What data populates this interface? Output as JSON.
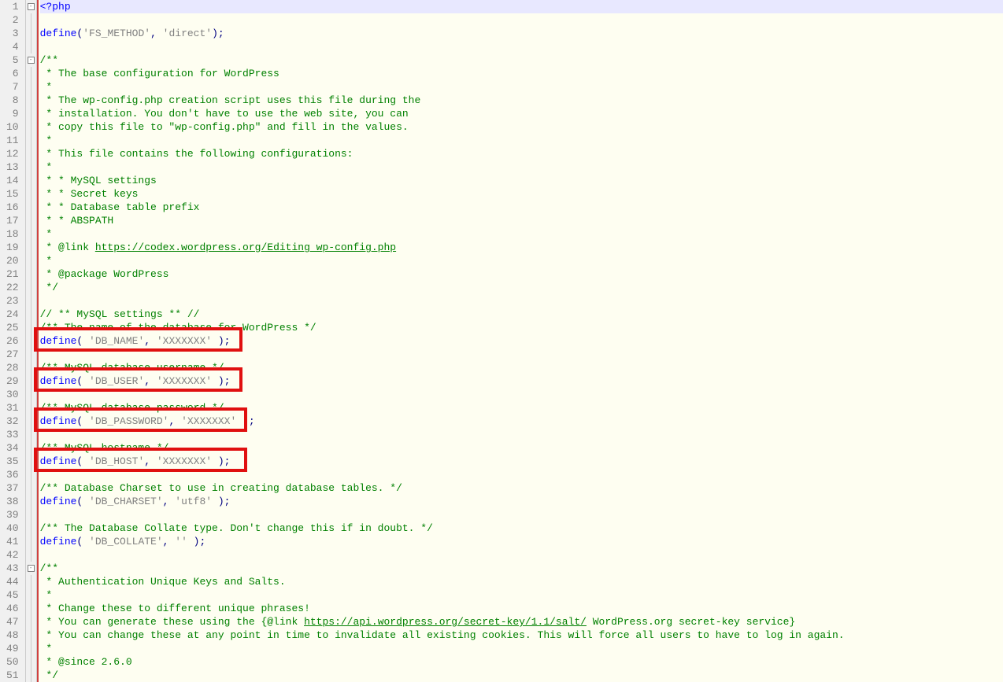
{
  "lines": {
    "1": [
      [
        "kw",
        "<?php"
      ]
    ],
    "2": [],
    "3": [
      [
        "kw",
        "define"
      ],
      [
        "pun",
        "("
      ],
      [
        "str",
        "'FS_METHOD'"
      ],
      [
        "pun",
        ", "
      ],
      [
        "str",
        "'direct'"
      ],
      [
        "pun",
        ");"
      ]
    ],
    "4": [],
    "5": [
      [
        "cmt",
        "/**"
      ]
    ],
    "6": [
      [
        "cmt",
        " * The base configuration for WordPress"
      ]
    ],
    "7": [
      [
        "cmt",
        " *"
      ]
    ],
    "8": [
      [
        "cmt",
        " * The wp-config.php creation script uses this file during the"
      ]
    ],
    "9": [
      [
        "cmt",
        " * installation. You don't have to use the web site, you can"
      ]
    ],
    "10": [
      [
        "cmt",
        " * copy this file to \"wp-config.php\" and fill in the values."
      ]
    ],
    "11": [
      [
        "cmt",
        " *"
      ]
    ],
    "12": [
      [
        "cmt",
        " * This file contains the following configurations:"
      ]
    ],
    "13": [
      [
        "cmt",
        " *"
      ]
    ],
    "14": [
      [
        "cmt",
        " * * MySQL settings"
      ]
    ],
    "15": [
      [
        "cmt",
        " * * Secret keys"
      ]
    ],
    "16": [
      [
        "cmt",
        " * * Database table prefix"
      ]
    ],
    "17": [
      [
        "cmt",
        " * * ABSPATH"
      ]
    ],
    "18": [
      [
        "cmt",
        " *"
      ]
    ],
    "19": [
      [
        "cmt",
        " * @link "
      ],
      [
        "lnk",
        "https://codex.wordpress.org/Editing_wp-config.php"
      ]
    ],
    "20": [
      [
        "cmt",
        " *"
      ]
    ],
    "21": [
      [
        "cmt",
        " * @package WordPress"
      ]
    ],
    "22": [
      [
        "cmt",
        " */"
      ]
    ],
    "23": [],
    "24": [
      [
        "cmt",
        "// ** MySQL settings ** //"
      ]
    ],
    "25": [
      [
        "cmt",
        "/** The name of the database for WordPress */"
      ]
    ],
    "26": [
      [
        "kw",
        "define"
      ],
      [
        "pun",
        "( "
      ],
      [
        "str",
        "'DB_NAME'"
      ],
      [
        "pun",
        ", "
      ],
      [
        "str",
        "'XXXXXXX'"
      ],
      [
        "pun",
        " );"
      ]
    ],
    "27": [],
    "28": [
      [
        "cmt",
        "/** MySQL database username */"
      ]
    ],
    "29": [
      [
        "kw",
        "define"
      ],
      [
        "pun",
        "( "
      ],
      [
        "str",
        "'DB_USER'"
      ],
      [
        "pun",
        ", "
      ],
      [
        "str",
        "'XXXXXXX'"
      ],
      [
        "pun",
        " );"
      ]
    ],
    "30": [],
    "31": [
      [
        "cmt",
        "/** MySQL database password */"
      ]
    ],
    "32": [
      [
        "kw",
        "define"
      ],
      [
        "pun",
        "( "
      ],
      [
        "str",
        "'DB_PASSWORD'"
      ],
      [
        "pun",
        ", "
      ],
      [
        "str",
        "'XXXXXXX'"
      ],
      [
        "pun",
        " );"
      ]
    ],
    "33": [],
    "34": [
      [
        "cmt",
        "/** MySQL hostname */"
      ]
    ],
    "35": [
      [
        "kw",
        "define"
      ],
      [
        "pun",
        "( "
      ],
      [
        "str",
        "'DB_HOST'"
      ],
      [
        "pun",
        ", "
      ],
      [
        "str",
        "'XXXXXXX'"
      ],
      [
        "pun",
        " );"
      ]
    ],
    "36": [],
    "37": [
      [
        "cmt",
        "/** Database Charset to use in creating database tables. */"
      ]
    ],
    "38": [
      [
        "kw",
        "define"
      ],
      [
        "pun",
        "( "
      ],
      [
        "str",
        "'DB_CHARSET'"
      ],
      [
        "pun",
        ", "
      ],
      [
        "str",
        "'utf8'"
      ],
      [
        "pun",
        " );"
      ]
    ],
    "39": [],
    "40": [
      [
        "cmt",
        "/** The Database Collate type. Don't change this if in doubt. */"
      ]
    ],
    "41": [
      [
        "kw",
        "define"
      ],
      [
        "pun",
        "( "
      ],
      [
        "str",
        "'DB_COLLATE'"
      ],
      [
        "pun",
        ", "
      ],
      [
        "str",
        "''"
      ],
      [
        "pun",
        " );"
      ]
    ],
    "42": [],
    "43": [
      [
        "cmt",
        "/**"
      ]
    ],
    "44": [
      [
        "cmt",
        " * Authentication Unique Keys and Salts."
      ]
    ],
    "45": [
      [
        "cmt",
        " *"
      ]
    ],
    "46": [
      [
        "cmt",
        " * Change these to different unique phrases!"
      ]
    ],
    "47": [
      [
        "cmt",
        " * You can generate these using the {@link "
      ],
      [
        "lnk",
        "https://api.wordpress.org/secret-key/1.1/salt/"
      ],
      [
        "cmt",
        " WordPress.org secret-key service}"
      ]
    ],
    "48": [
      [
        "cmt",
        " * You can change these at any point in time to invalidate all existing cookies. This will force all users to have to log in again."
      ]
    ],
    "49": [
      [
        "cmt",
        " *"
      ]
    ],
    "50": [
      [
        "cmt",
        " * @since 2.6.0"
      ]
    ],
    "51": [
      [
        "cmt",
        " */"
      ]
    ]
  },
  "foldMarkers": {
    "1": true,
    "5": true,
    "43": true
  },
  "totalLines": 51
}
